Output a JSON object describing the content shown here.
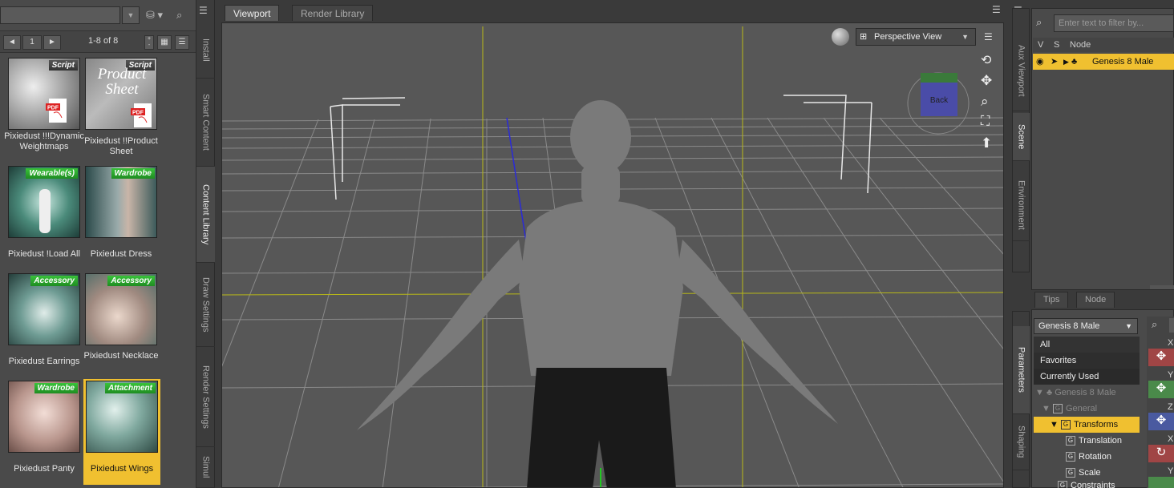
{
  "left": {
    "page_number": "1",
    "page_count": "1-8 of 8",
    "tiles": [
      {
        "badge": "Script",
        "label": "Pixiedust !!!Dynamic Weightmaps",
        "badge_style": "dark"
      },
      {
        "badge": "Script",
        "label": "Pixiedust !!Product Sheet",
        "badge_style": "dark",
        "overlay": "Product Sheet"
      },
      {
        "badge": "Wearable(s)",
        "label": "Pixiedust !Load All",
        "badge_style": "green"
      },
      {
        "badge": "Wardrobe",
        "label": "Pixiedust Dress",
        "badge_style": "green"
      },
      {
        "badge": "Accessory",
        "label": "Pixiedust Earrings",
        "badge_style": "green"
      },
      {
        "badge": "Accessory",
        "label": "Pixiedust Necklace",
        "badge_style": "green"
      },
      {
        "badge": "Wardrobe",
        "label": "Pixiedust Panty",
        "badge_style": "green"
      },
      {
        "badge": "Attachment",
        "label": "Pixiedust Wings",
        "badge_style": "green"
      }
    ],
    "pdf_label": "PDF"
  },
  "vtabs": [
    "Install",
    "Smart Content",
    "Content Library",
    "Draw Settings",
    "Render Settings",
    "Simul"
  ],
  "viewport": {
    "tabs": [
      "Viewport",
      "Render Library"
    ],
    "view_name": "Perspective View",
    "cube_face": "Back"
  },
  "right": {
    "vtabs_top": [
      "Aux Viewport",
      "Scene",
      "Environment"
    ],
    "vtabs_bottom": [
      "Parameters",
      "Shaping"
    ],
    "filter_placeholder": "Enter text to filter by...",
    "scene_cols": [
      "V",
      "S",
      "Node"
    ],
    "scene_node": "Genesis 8 Male",
    "tips_tabs": [
      "Tips",
      "Node"
    ],
    "param_figure": "Genesis 8 Male",
    "param_groups": [
      "All",
      "Favorites",
      "Currently Used"
    ],
    "tree": [
      {
        "label": "Genesis 8 Male",
        "dim": true
      },
      {
        "label": "General",
        "dim": true
      },
      {
        "label": "Transforms",
        "selected": true
      },
      {
        "label": "Translation"
      },
      {
        "label": "Rotation"
      },
      {
        "label": "Scale"
      },
      {
        "label": "Constraints"
      }
    ],
    "slider_axes": [
      "X",
      "Y",
      "Z",
      "X",
      "Y"
    ]
  },
  "colors": {
    "selected": "#f0c030",
    "badge_green": "#2aa52c",
    "viewport": "#575757"
  }
}
